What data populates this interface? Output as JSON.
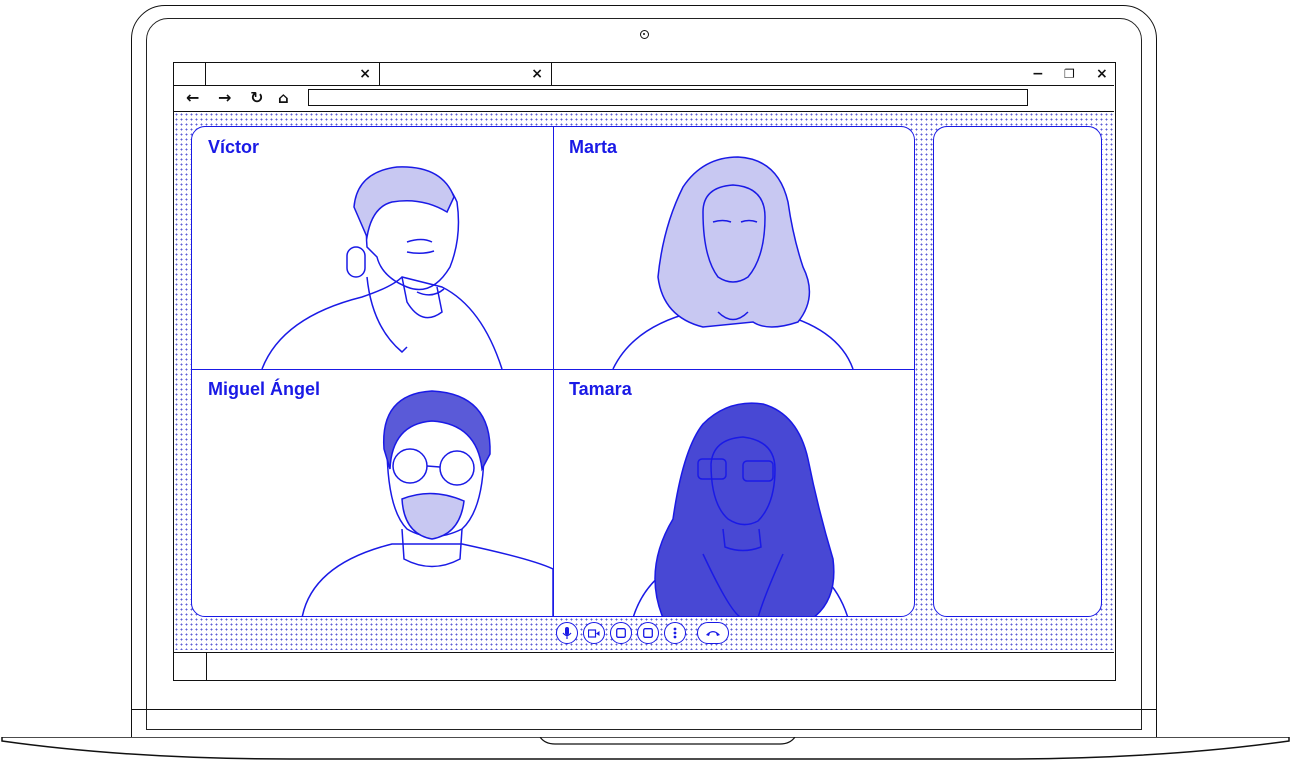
{
  "browser": {
    "tabs": [
      {
        "label": "",
        "close": "×"
      },
      {
        "label": "",
        "close": "×"
      }
    ],
    "window_controls": {
      "minimize": "−",
      "restore": "❐",
      "close": "×"
    },
    "nav": {
      "back": "←",
      "forward": "→",
      "reload": "↻",
      "home": "⌂"
    },
    "url": ""
  },
  "call": {
    "participants": [
      {
        "name": "Víctor"
      },
      {
        "name": "Marta"
      },
      {
        "name": "Miguel Ángel"
      },
      {
        "name": "Tamara"
      }
    ],
    "controls": [
      {
        "icon": "microphone-icon",
        "glyph": "🎙"
      },
      {
        "icon": "camera-icon",
        "glyph": "▸"
      },
      {
        "icon": "screen-share-icon",
        "glyph": "□"
      },
      {
        "icon": "window-icon",
        "glyph": "□"
      },
      {
        "icon": "more-icon",
        "glyph": "⋮"
      },
      {
        "icon": "hang-up-icon",
        "glyph": "☎"
      }
    ]
  },
  "colors": {
    "accent": "#1a1ae6",
    "outline": "#111111"
  }
}
